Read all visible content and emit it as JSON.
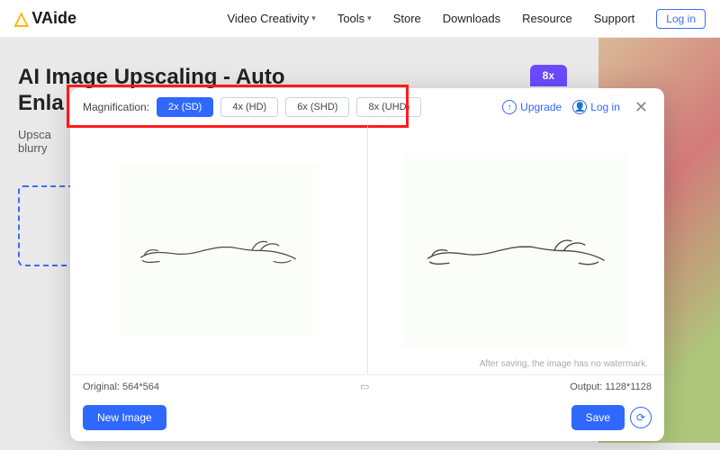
{
  "nav": {
    "brand": "VAide",
    "items": [
      "Video Creativity",
      "Tools",
      "Store",
      "Downloads",
      "Resource",
      "Support"
    ],
    "login": "Log in"
  },
  "bg": {
    "title_line1": "AI Image Upscaling - Auto",
    "title_line2": "Enla",
    "desc_line1": "Upsca",
    "desc_line2": "blurry",
    "pill": "8x"
  },
  "modal": {
    "mag_label": "Magnification:",
    "mag_options": [
      {
        "label": "2x (SD)",
        "active": true
      },
      {
        "label": "4x (HD)",
        "active": false
      },
      {
        "label": "6x (SHD)",
        "active": false
      },
      {
        "label": "8x (UHD)",
        "active": false
      }
    ],
    "upgrade": "Upgrade",
    "login": "Log in",
    "watermark_note": "After saving, the image has no watermark.",
    "original_label": "Original: 564*564",
    "output_label": "Output: 1128*1128",
    "new_image": "New Image",
    "save": "Save"
  }
}
